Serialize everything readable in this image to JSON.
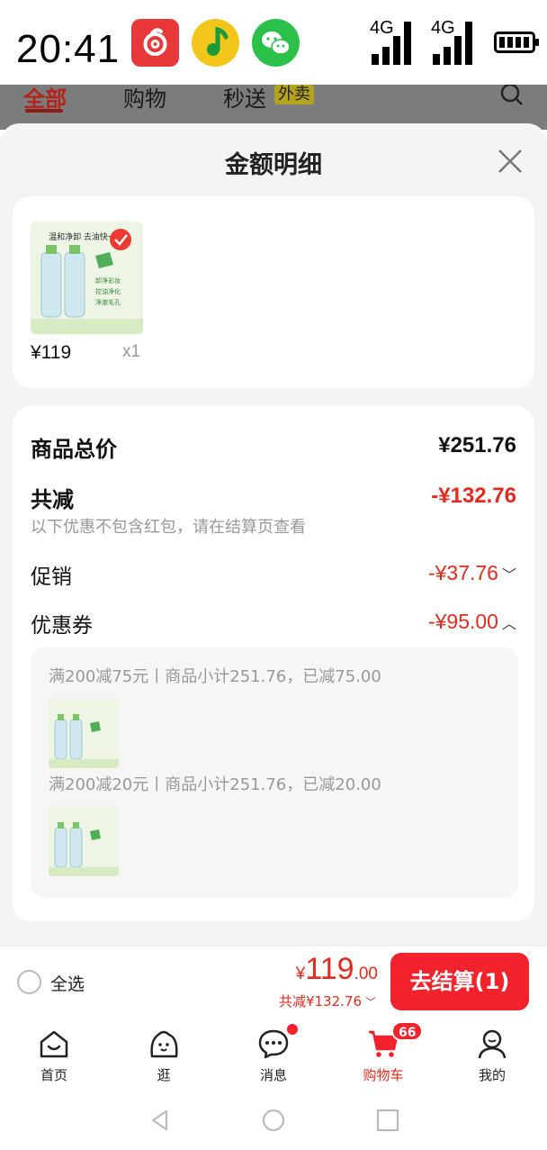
{
  "status_bar": {
    "time": "20:41",
    "signal1": "4G",
    "signal2": "4G",
    "apps": [
      "netease-music-icon",
      "qq-music-icon",
      "wechat-icon"
    ]
  },
  "background_header": {
    "tabs": [
      "全部",
      "购物",
      "秒送"
    ],
    "badge": "外卖"
  },
  "sheet": {
    "title": "金额明细",
    "product": {
      "price": "¥119",
      "qty": "x1",
      "thumb_text": "温和净卸 去油快一步",
      "thumb_tags": [
        "卸净彩妆",
        "控油净化",
        "净澈毛孔"
      ]
    },
    "summary": {
      "total_label": "商品总价",
      "total_value": "¥251.76",
      "discount_label": "共减",
      "discount_value": "-¥132.76",
      "note": "以下优惠不包含红包，请在结算页查看",
      "promo_label": "促销",
      "promo_value": "-¥37.76",
      "coupon_label": "优惠券",
      "coupon_value": "-¥95.00"
    },
    "coupons": [
      {
        "text": "满200减75元丨商品小计251.76，已减75.00"
      },
      {
        "text": "满200减20元丨商品小计251.76，已减20.00"
      }
    ]
  },
  "checkout": {
    "select_all": "全选",
    "yen": "¥",
    "price_big": "119",
    "price_cents": ".00",
    "saving": "共减¥132.76",
    "pay_button": "去结算(1)"
  },
  "tabbar": {
    "items": [
      {
        "label": "首页",
        "icon": "home-icon"
      },
      {
        "label": "逛",
        "icon": "browse-icon"
      },
      {
        "label": "消息",
        "icon": "message-icon"
      },
      {
        "label": "购物车",
        "icon": "cart-icon"
      },
      {
        "label": "我的",
        "icon": "profile-icon"
      }
    ],
    "cart_badge": "66"
  },
  "colors": {
    "accent_red": "#e22b1e",
    "button_red": "#f2232c"
  }
}
